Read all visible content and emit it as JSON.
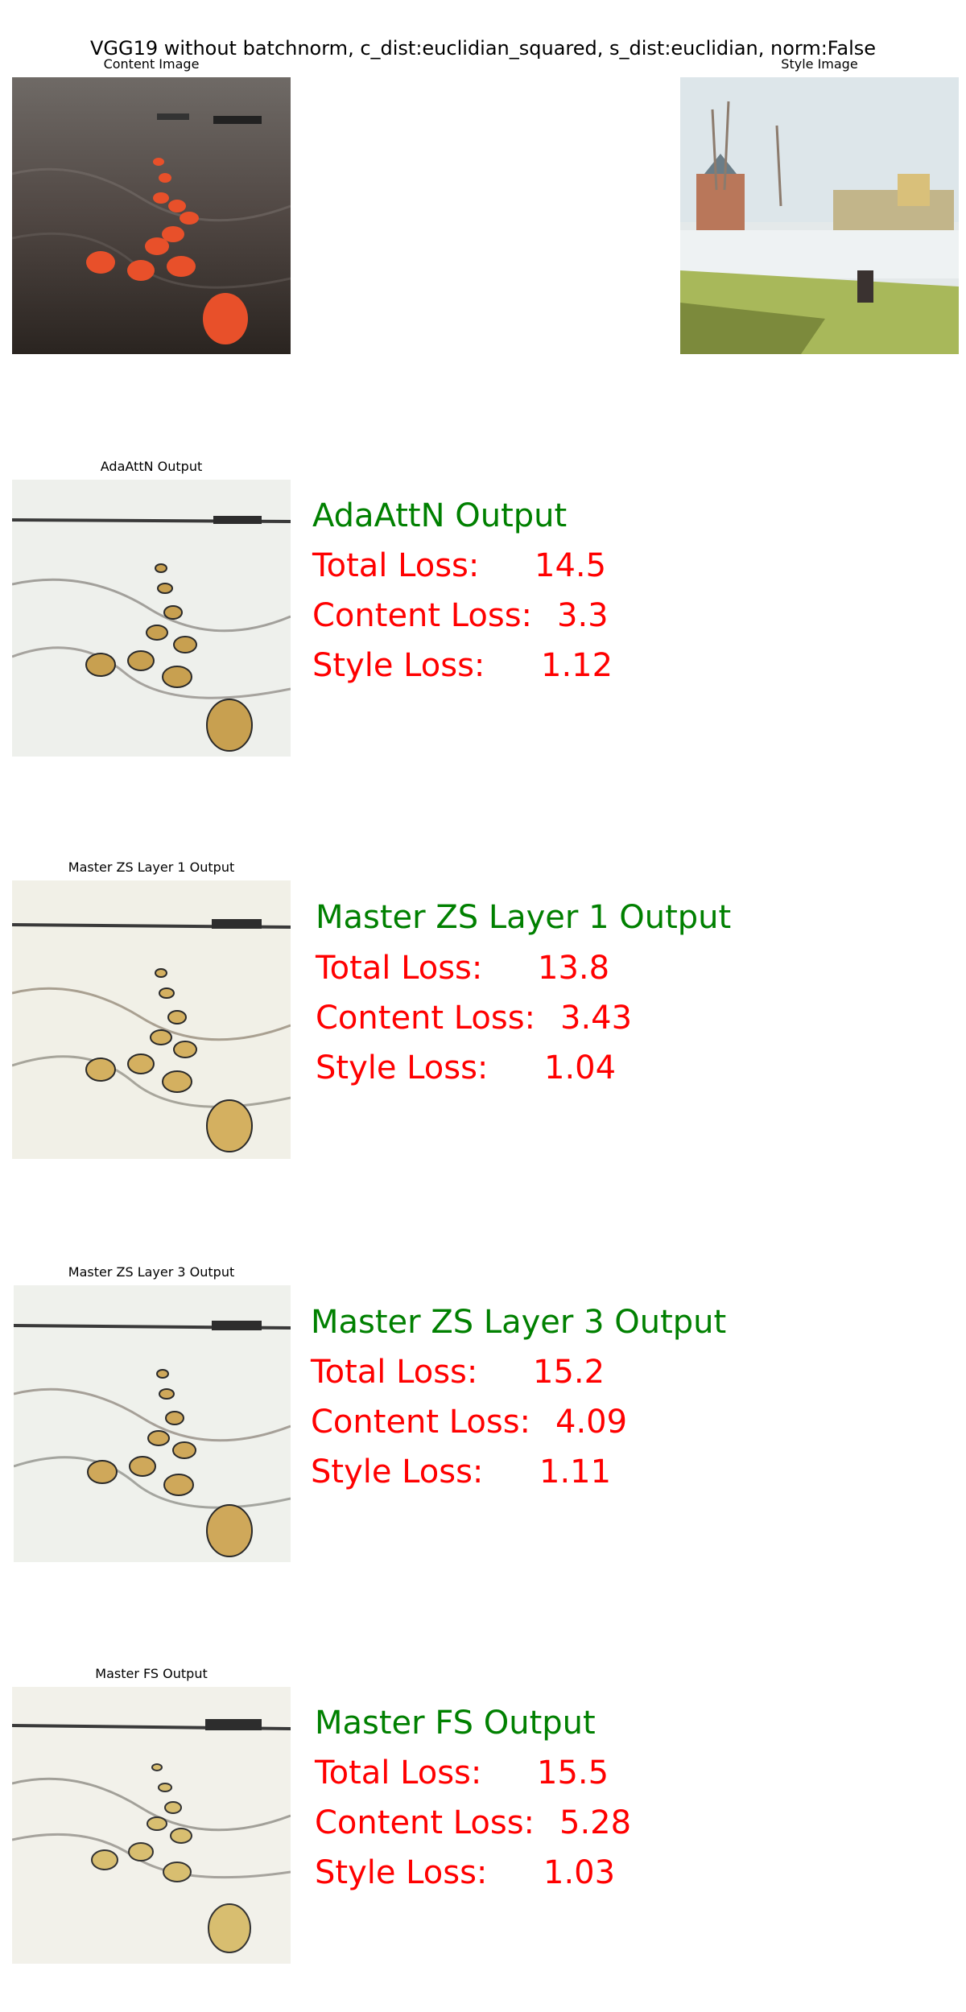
{
  "figure_title": "VGG19 without batchnorm, c_dist:euclidian_squared, s_dist:euclidian, norm:False",
  "colors": {
    "method": "#008000",
    "metric": "#ff0000"
  },
  "content_image": {
    "caption": "Content Image"
  },
  "style_image": {
    "caption": "Style Image"
  },
  "metric_labels": {
    "total": "Total Loss:",
    "content": "Content Loss:",
    "style": "Style Loss:"
  },
  "rows": [
    {
      "caption": "AdaAttN Output",
      "method": "AdaAttN Output",
      "total": "14.5",
      "content": "3.3",
      "style": "1.12"
    },
    {
      "caption": "Master ZS Layer 1 Output",
      "method": "Master ZS Layer 1 Output",
      "total": "13.8",
      "content": "3.43",
      "style": "1.04"
    },
    {
      "caption": "Master ZS Layer 3 Output",
      "method": "Master ZS Layer 3 Output",
      "total": "15.2",
      "content": "4.09",
      "style": "1.11"
    },
    {
      "caption": "Master FS Output",
      "method": "Master FS Output",
      "total": "15.5",
      "content": "5.28",
      "style": "1.03"
    }
  ]
}
